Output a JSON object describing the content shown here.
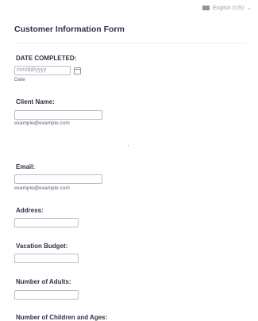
{
  "language": {
    "label": "English (US)"
  },
  "form": {
    "title": "Customer Information Form"
  },
  "date_completed": {
    "label": "DATE COMPLETED:",
    "placeholder": "mm/dd/yyyy",
    "sublabel": "Date"
  },
  "client_name": {
    "label": "Client Name:",
    "sublabel": "example@example.com"
  },
  "email": {
    "label": "Email:",
    "sublabel": "example@example.com"
  },
  "address": {
    "label": "Address:"
  },
  "vacation_budget": {
    "label": "Vacation Budget:"
  },
  "number_of_adults": {
    "label": "Number of Adults:"
  },
  "number_of_children": {
    "label": "Number of Children and Ages:"
  }
}
